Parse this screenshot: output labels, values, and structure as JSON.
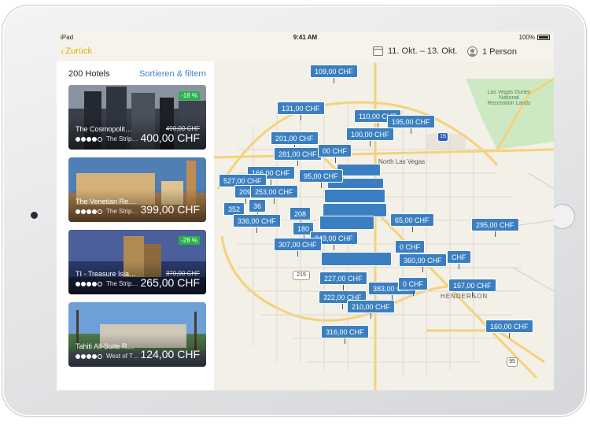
{
  "status": {
    "carrier": "iPad",
    "time": "9:41 AM",
    "battery": "100%"
  },
  "nav": {
    "back": "Zurück",
    "dates": "11. Okt. – 13. Okt.",
    "guests": "1 Person"
  },
  "panel": {
    "count": "200 Hotels",
    "sort": "Sortieren & filtern"
  },
  "hotels": [
    {
      "name": "The Cosmopolit…",
      "location": "The Strip…",
      "old_price": "490,00 CHF",
      "price": "400,00 CHF",
      "badge": "-18 %",
      "rating": 4
    },
    {
      "name": "The Venetian Re…",
      "location": "The Strip…",
      "old_price": "",
      "price": "399,00 CHF",
      "badge": "",
      "rating": 4
    },
    {
      "name": "TI - Treasure Isla…",
      "location": "The Strip…",
      "old_price": "370,00 CHF",
      "price": "265,00 CHF",
      "badge": "-28 %",
      "rating": 4
    },
    {
      "name": "Tahiti All-Suite R…",
      "location": "West of T…",
      "old_price": "",
      "price": "124,00 CHF",
      "badge": "",
      "rating": 4
    }
  ],
  "map": {
    "labels": {
      "north_lv": "North Las Vegas",
      "henderson": "HENDERSON",
      "park": "Las Vegas Dunes\nNational\nRecreation Lands",
      "route_215": "215",
      "route_15": "15",
      "route_95": "95"
    },
    "pins": [
      "109,00 CHF",
      "131,00 CHF",
      "110,00 CHF",
      "195,00 CHF",
      "201,00 CHF",
      "100,00 CHF",
      "281,00 CHF",
      "00 CHF",
      "166,00 CHF",
      "95,00 CHF",
      "527,00 CHF",
      "209",
      "253,00 CHF",
      "352",
      "208",
      "36",
      "336,00 CHF",
      "65,00 CHF",
      "295,00 CHF",
      "180",
      "249,00 CHF",
      "307,00 CHF",
      "0 CHF",
      "360,00 CHF",
      "CHF",
      "227,00 CHF",
      "383,00 CHF",
      "0 CHF",
      "157,00 CHF",
      "322,00 CHF",
      "210,00 CHF",
      "316,00 CHF",
      "160,00 CHF"
    ]
  },
  "colors": {
    "accent": "#e0b000",
    "pin": "#3b7fc0",
    "link": "#3f86c8",
    "badge": "#27b24a"
  }
}
